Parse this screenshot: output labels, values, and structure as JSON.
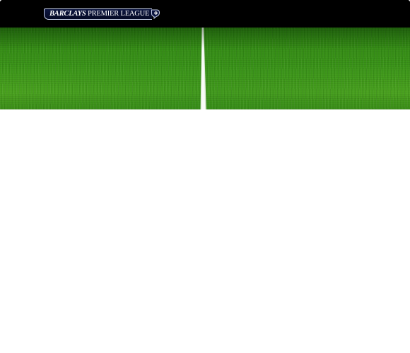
{
  "header": {
    "logo_brand": "BARCLAYS",
    "logo_league": "PREMIER LEAGUE",
    "logo_icon": "lion-crest-icon",
    "background_color": "#000000"
  },
  "hero": {
    "image": "football-pitch-grass",
    "grass_color": "#3a9418",
    "line_color": "#ffffff"
  },
  "content": {
    "background_color": "#ffffff"
  }
}
